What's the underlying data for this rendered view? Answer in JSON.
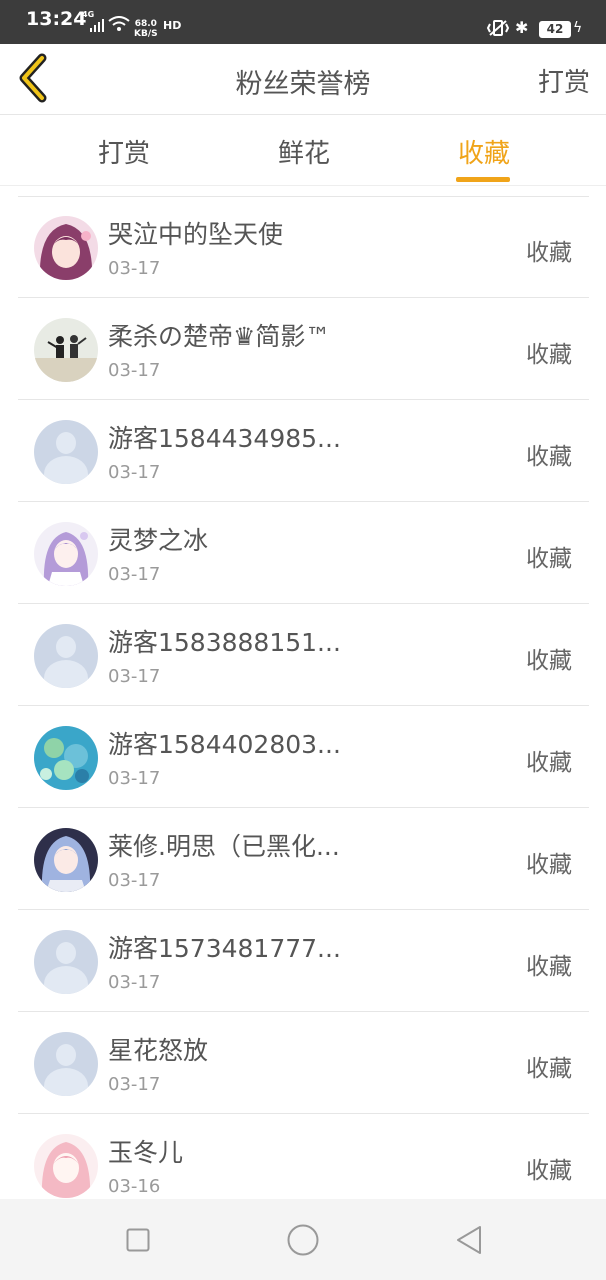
{
  "status_bar": {
    "time": "13:24",
    "network": "4G",
    "speed_value": "68.0",
    "speed_unit": "KB/S",
    "hd": "HD",
    "battery": "42"
  },
  "header": {
    "title": "粉丝荣誉榜",
    "action_label": "打赏"
  },
  "tabs": [
    {
      "label": "打赏",
      "active": false
    },
    {
      "label": "鲜花",
      "active": false
    },
    {
      "label": "收藏",
      "active": true
    }
  ],
  "accent_color": "#f0a419",
  "fans": [
    {
      "name": "哭泣中的坠天使",
      "date": "03-17",
      "action": "收藏",
      "avatar": "anime-girl-avatar"
    },
    {
      "name": "柔杀の楚帝♛简影™",
      "date": "03-17",
      "action": "收藏",
      "avatar": "photo-avatar"
    },
    {
      "name": "游客1584434985...",
      "date": "03-17",
      "action": "收藏",
      "avatar": "default-user-avatar"
    },
    {
      "name": "灵梦之冰",
      "date": "03-17",
      "action": "收藏",
      "avatar": "anime-girl-avatar"
    },
    {
      "name": "游客1583888151...",
      "date": "03-17",
      "action": "收藏",
      "avatar": "default-user-avatar"
    },
    {
      "name": "游客1584402803...",
      "date": "03-17",
      "action": "收藏",
      "avatar": "flower-avatar"
    },
    {
      "name": "莱修.明思（已黑化...",
      "date": "03-17",
      "action": "收藏",
      "avatar": "anime-girl-avatar"
    },
    {
      "name": "游客1573481777...",
      "date": "03-17",
      "action": "收藏",
      "avatar": "default-user-avatar"
    },
    {
      "name": "星花怒放",
      "date": "03-17",
      "action": "收藏",
      "avatar": "default-user-avatar"
    },
    {
      "name": "玉冬儿",
      "date": "03-16",
      "action": "收藏",
      "avatar": "anime-girl-avatar"
    }
  ]
}
